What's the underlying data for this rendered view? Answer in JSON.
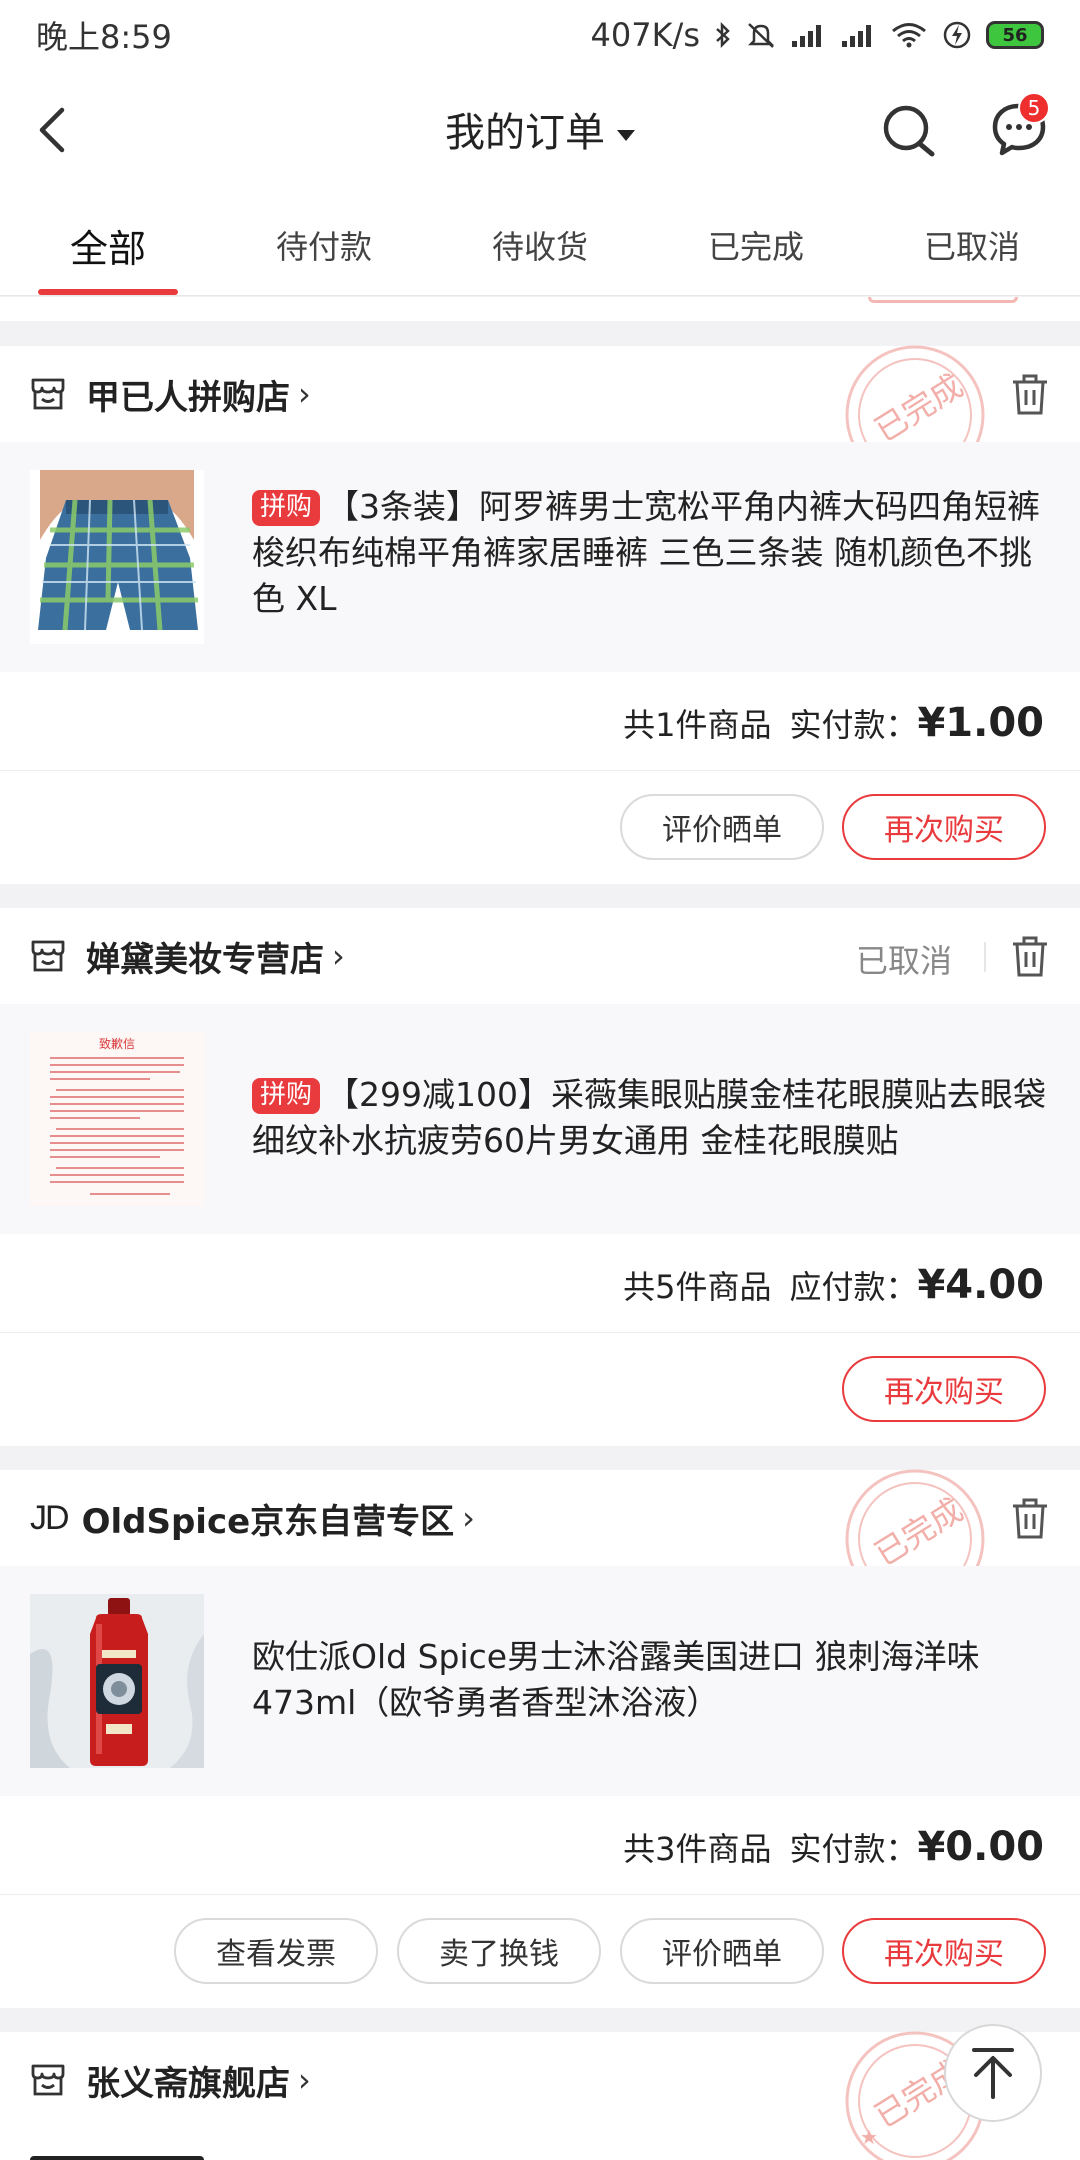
{
  "status_bar": {
    "time": "晚上8:59",
    "network_speed": "407K/s",
    "battery": "56",
    "icons": [
      "bluetooth-icon",
      "mute-icon",
      "signal-icon",
      "signal-icon",
      "wifi-icon",
      "charging-icon"
    ]
  },
  "header": {
    "title": "我的订单",
    "message_badge": "5",
    "icons": [
      "back-icon",
      "search-icon",
      "message-icon"
    ]
  },
  "tabs": [
    {
      "label": "全部",
      "active": true
    },
    {
      "label": "待付款",
      "active": false
    },
    {
      "label": "待收货",
      "active": false
    },
    {
      "label": "已完成",
      "active": false
    },
    {
      "label": "已取消",
      "active": false
    }
  ],
  "orders": [
    {
      "store": "甲已人拼购店",
      "store_icon": "store-icon",
      "stamp": "已完成",
      "tag": "拼购",
      "title": "【3条装】阿罗裤男士宽松平角内裤大码四角短裤梭织布纯棉平角裤家居睡裤 三色三条装 随机颜色不挑色 XL",
      "count_text": "共1件商品",
      "pay_label": "实付款：",
      "amount": "¥1.00",
      "buttons": [
        "评价晒单",
        "再次购买"
      ]
    },
    {
      "store": "婵黛美妆专营店",
      "store_icon": "store-icon",
      "status": "已取消",
      "tag": "拼购",
      "title": "【299减100】采薇集眼贴膜金桂花眼膜贴去眼袋细纹补水抗疲劳60片男女通用 金桂花眼膜贴",
      "count_text": "共5件商品",
      "pay_label": "应付款：",
      "amount": "¥4.00",
      "buttons": [
        "再次购买"
      ],
      "thumb_heading": "致歉信"
    },
    {
      "store": "OldSpice京东自营专区",
      "store_icon": "jd-logo",
      "logo_text": "JD",
      "stamp": "已完成",
      "title": "欧仕派Old Spice男士沐浴露美国进口 狼刺海洋味473ml（欧爷勇者香型沐浴液）",
      "count_text": "共3件商品",
      "pay_label": "实付款：",
      "amount": "¥0.00",
      "buttons": [
        "查看发票",
        "卖了换钱",
        "评价晒单",
        "再次购买"
      ]
    },
    {
      "store": "张义斋旗舰店",
      "store_icon": "store-icon",
      "stamp": "已完成"
    }
  ],
  "fab_icon": "back-to-top-icon",
  "colors": {
    "accent": "#e93b3d",
    "background": "#f2f2f4",
    "product_bg": "#f8f8fa",
    "stamp": "#f2b3ae"
  }
}
